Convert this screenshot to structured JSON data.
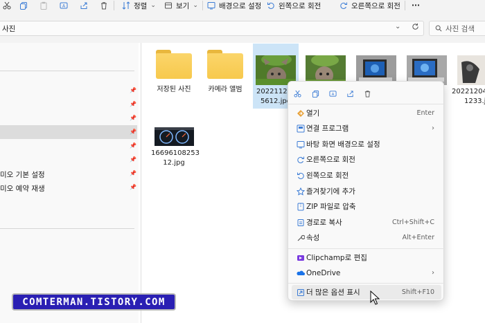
{
  "toolbar": {
    "sort_label": "정렬",
    "view_label": "보기",
    "set_background_label": "배경으로 설정",
    "rotate_left_label": "왼쪽으로 회전",
    "rotate_right_label": "오른쪽으로 회전",
    "more_label": "···"
  },
  "address": {
    "path": "사진",
    "search_placeholder": "사진 검색"
  },
  "nav": {
    "items": [
      {
        "label": "미오 기본 설정"
      },
      {
        "label": "미오 예약 재생"
      }
    ]
  },
  "files": [
    {
      "name": "저장된 사진",
      "kind": "folder"
    },
    {
      "name": "카메라 앨범",
      "kind": "folder"
    },
    {
      "name": "20221121_5612.jpg",
      "line1": "20221121_",
      "line2": "5612.jpg",
      "kind": "image",
      "selected": true
    },
    {
      "name": "20221204 1233.jpg",
      "line1": "20221204",
      "line2": "1233.jpg",
      "kind": "image"
    },
    {
      "name": "1669610825312.jpg",
      "line1": "16696108253",
      "line2": "12.jpg",
      "kind": "image"
    }
  ],
  "context_menu": {
    "items": [
      {
        "label": "열기",
        "shortcut": "Enter"
      },
      {
        "label": "연결 프로그램",
        "submenu": true
      },
      {
        "label": "바탕 화면 배경으로 설정"
      },
      {
        "label": "오른쪽으로 회전"
      },
      {
        "label": "왼쪽으로 회전"
      },
      {
        "label": "즐겨찾기에 추가"
      },
      {
        "label": "ZIP 파일로 압축"
      },
      {
        "label": "경로로 복사",
        "shortcut": "Ctrl+Shift+C"
      },
      {
        "label": "속성",
        "shortcut": "Alt+Enter"
      },
      {
        "label": "Clipchamp로 편집"
      },
      {
        "label": "OneDrive",
        "submenu": true
      },
      {
        "label": "더 많은 옵션 표시",
        "shortcut": "Shift+F10"
      }
    ],
    "submenu_arrow": "›"
  },
  "watermark": "COMTERMAN.TISTORY.COM",
  "colors": {
    "accent": "#0067c0",
    "folder": "#f7c94d",
    "selection": "#cce4f7",
    "watermark_bg": "#2a1fb3"
  },
  "icons": {
    "toolbar": [
      "copy-icon",
      "paste-icon",
      "rename-icon",
      "share-icon",
      "delete-icon",
      "sort-icon",
      "view-icon",
      "background-icon",
      "rotate-left-icon",
      "rotate-right-icon"
    ],
    "context": [
      "cut-icon",
      "copy-icon",
      "rename-icon",
      "share-icon",
      "delete-icon"
    ]
  }
}
